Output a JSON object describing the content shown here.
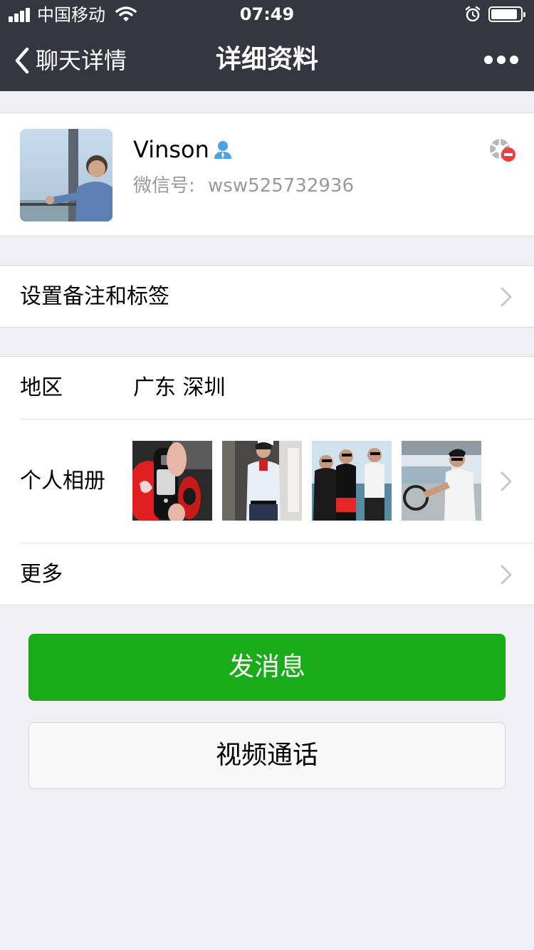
{
  "status_bar": {
    "carrier": "中国移动",
    "time": "07:49"
  },
  "nav": {
    "back_label": "聊天详情",
    "title": "详细资料",
    "more_icon": "more-dots-icon"
  },
  "profile": {
    "name": "Vinson",
    "wechat_id_label": "微信号:",
    "wechat_id": "wsw525732936",
    "gender_icon": "male-user-icon",
    "moments_icon": "moments-blocked-icon"
  },
  "remark_row": {
    "label": "设置备注和标签"
  },
  "region_row": {
    "label": "地区",
    "value": "广东 深圳"
  },
  "album_row": {
    "label": "个人相册",
    "photos": [
      "car-keys-photo",
      "mirror-selfie-photo",
      "group-of-friends-photo",
      "boat-driving-photo"
    ]
  },
  "more_row": {
    "label": "更多"
  },
  "actions": {
    "send_message": "发消息",
    "video_call": "视频通话"
  },
  "colors": {
    "nav_background": "#363640",
    "page_background": "#efeff4",
    "primary_green": "#1aad19",
    "gender_icon": "#4aa2e8",
    "secondary_text": "#999999"
  }
}
